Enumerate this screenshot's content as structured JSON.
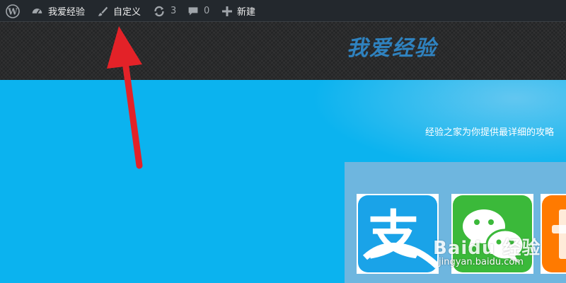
{
  "admin_bar": {
    "items": [
      {
        "icon": "wordpress-logo-icon",
        "label": ""
      },
      {
        "icon": "dashboard-icon",
        "label": "我爱经验"
      },
      {
        "icon": "paintbrush-icon",
        "label": "自定义"
      },
      {
        "icon": "updates-icon",
        "label": "3"
      },
      {
        "icon": "comment-icon",
        "label": "0"
      },
      {
        "icon": "plus-icon",
        "label": "新建"
      }
    ]
  },
  "header": {
    "site_title": "我爱经验"
  },
  "main": {
    "tagline": "经验之家为你提供最详细的攻略"
  },
  "apps": [
    {
      "name": "alipay",
      "icon": "alipay-icon",
      "glyph": "支",
      "color": "#1aa3e8"
    },
    {
      "name": "wechat",
      "icon": "wechat-icon",
      "color": "#3bb93a"
    },
    {
      "name": "taobao",
      "icon": "orange-app-icon",
      "color": "#ff7a00"
    }
  ],
  "watermark": {
    "brand": "Baidu 经验",
    "url": "jingyan.baidu.com"
  },
  "colors": {
    "admin_bar": "#23282d",
    "main_bg": "#0bb3ef",
    "title": "#2f82bf",
    "arrow": "#e32228"
  }
}
